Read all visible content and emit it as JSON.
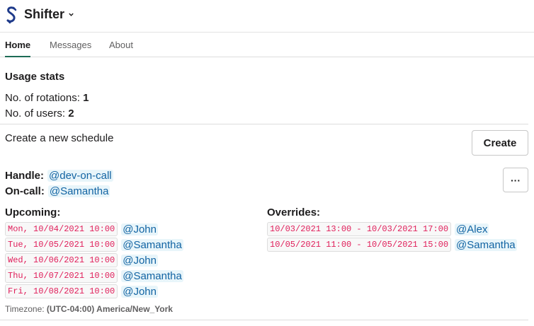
{
  "app": {
    "name": "Shifter",
    "brand_color": "#1e3a8a"
  },
  "tabs": [
    {
      "label": "Home",
      "active": true
    },
    {
      "label": "Messages",
      "active": false
    },
    {
      "label": "About",
      "active": false
    }
  ],
  "usage": {
    "title": "Usage stats",
    "rotations_label": "No. of rotations:",
    "rotations_value": "1",
    "users_label": "No. of users:",
    "users_value": "2"
  },
  "create": {
    "text": "Create a new schedule",
    "button_label": "Create"
  },
  "schedule": {
    "handle_label": "Handle:",
    "handle_value": "@dev-on-call",
    "oncall_label": "On-call:",
    "oncall_value": "@Samantha",
    "more_label": "···",
    "upcoming_label": "Upcoming:",
    "upcoming": [
      {
        "time": "Mon, 10/04/2021 10:00",
        "user": "@John"
      },
      {
        "time": "Tue, 10/05/2021 10:00",
        "user": "@Samantha"
      },
      {
        "time": "Wed, 10/06/2021 10:00",
        "user": "@John"
      },
      {
        "time": "Thu, 10/07/2021 10:00",
        "user": "@Samantha"
      },
      {
        "time": "Fri, 10/08/2021 10:00",
        "user": "@John"
      }
    ],
    "overrides_label": "Overrides:",
    "overrides": [
      {
        "time": "10/03/2021 13:00 - 10/03/2021 17:00",
        "user": "@Alex"
      },
      {
        "time": "10/05/2021 11:00 - 10/05/2021 15:00",
        "user": "@Samantha"
      }
    ],
    "timezone_label": "Timezone:",
    "timezone_value": "(UTC-04:00) America/New_York"
  }
}
